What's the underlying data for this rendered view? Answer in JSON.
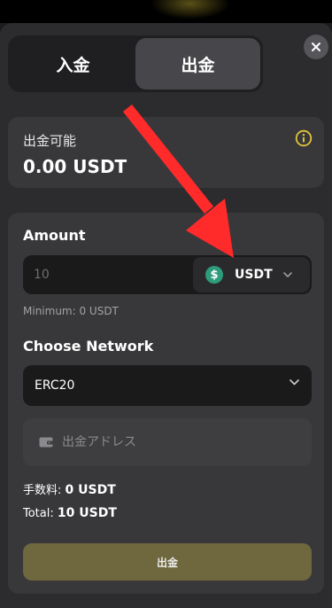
{
  "tabs": [
    {
      "label": "入金",
      "active": false
    },
    {
      "label": "出金",
      "active": true
    }
  ],
  "balance": {
    "label": "出金可能",
    "value": "0.00 USDT"
  },
  "amount": {
    "label": "Amount",
    "placeholder": "10",
    "currency": "USDT",
    "currency_icon": "dollar-coin-icon",
    "minimum_text": "Minimum: 0 USDT"
  },
  "network": {
    "label": "Choose Network",
    "selected": "ERC20"
  },
  "address": {
    "placeholder": "出金アドレス",
    "icon": "wallet-icon"
  },
  "fee": {
    "label": "手数料:",
    "value": "0 USDT"
  },
  "total": {
    "label": "Total:",
    "value": "10 USDT"
  },
  "submit_label": "出金",
  "colors": {
    "accent_button": "#6f673e",
    "coin": "#2e9b7a",
    "info_icon": "#e2c43a",
    "annotation_arrow": "#ff2a2a"
  }
}
